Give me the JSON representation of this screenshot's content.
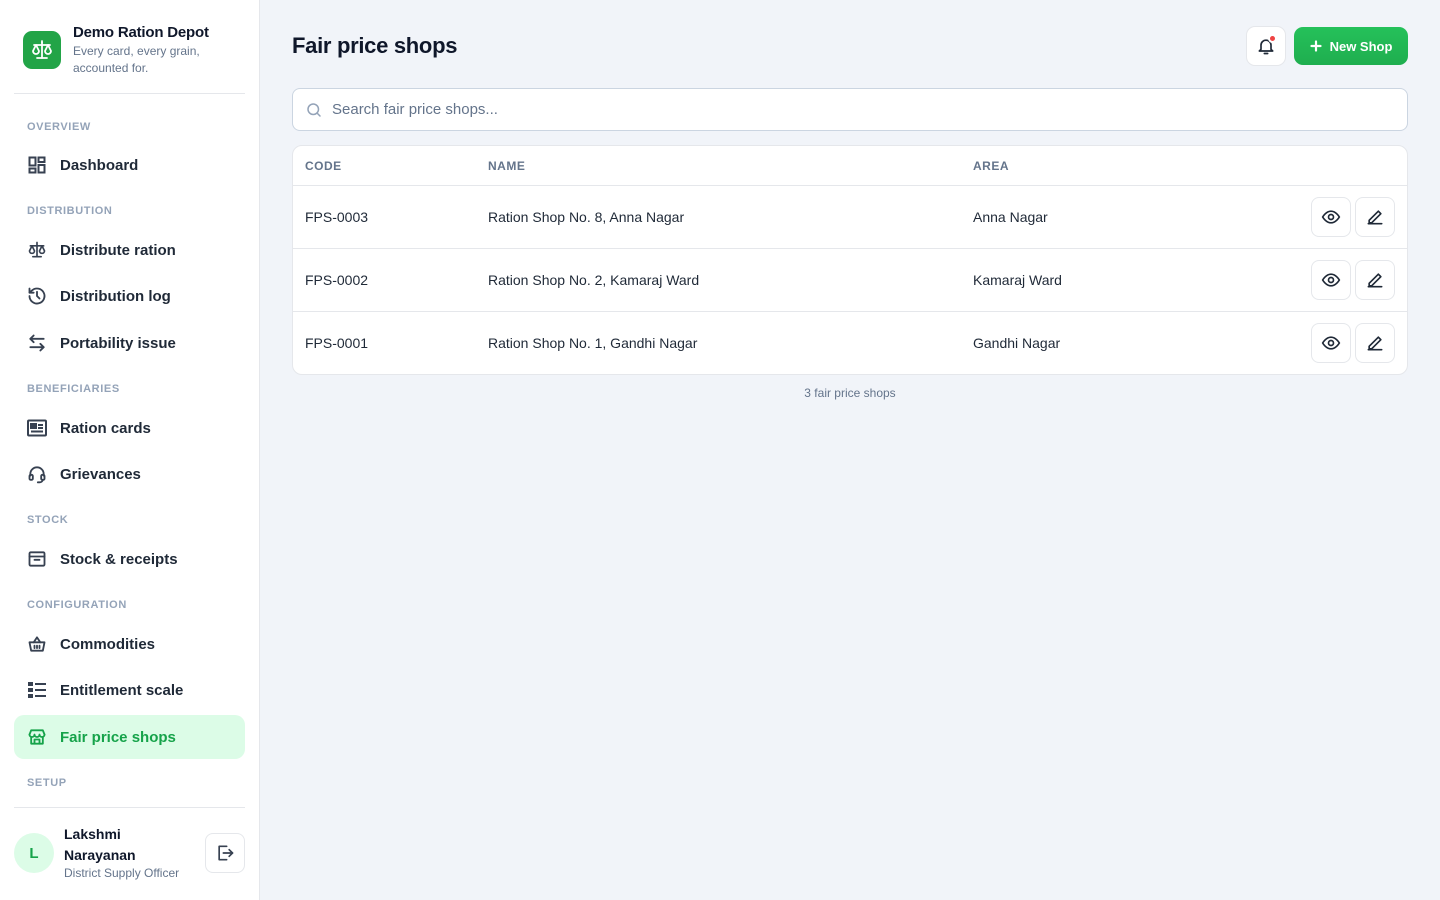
{
  "brand": {
    "name": "Demo Ration Depot",
    "tagline": "Every card, every grain, accounted for."
  },
  "sidebar": {
    "sections": [
      {
        "label": "OVERVIEW"
      },
      {
        "label": "DISTRIBUTION"
      },
      {
        "label": "BENEFICIARIES"
      },
      {
        "label": "STOCK"
      },
      {
        "label": "CONFIGURATION"
      },
      {
        "label": "SETUP"
      }
    ],
    "items": [
      {
        "label": "Dashboard",
        "icon": "dashboard-icon"
      },
      {
        "label": "Distribute ration",
        "icon": "scale-icon"
      },
      {
        "label": "Distribution log",
        "icon": "history-icon"
      },
      {
        "label": "Portability issue",
        "icon": "swap-arrows-icon"
      },
      {
        "label": "Ration cards",
        "icon": "id-card-icon"
      },
      {
        "label": "Grievances",
        "icon": "headset-icon"
      },
      {
        "label": "Stock & receipts",
        "icon": "archive-box-icon"
      },
      {
        "label": "Commodities",
        "icon": "basket-icon"
      },
      {
        "label": "Entitlement scale",
        "icon": "list-grid-icon"
      },
      {
        "label": "Fair price shops",
        "icon": "store-icon",
        "active": true
      }
    ]
  },
  "user": {
    "initial": "L",
    "name": "Lakshmi Narayanan",
    "role": "District Supply Officer"
  },
  "header": {
    "title": "Fair price shops",
    "new_button": "New Shop"
  },
  "search": {
    "placeholder": "Search fair price shops...",
    "value": ""
  },
  "table": {
    "columns": [
      "CODE",
      "NAME",
      "AREA"
    ],
    "rows": [
      {
        "code": "FPS-0003",
        "name": "Ration Shop No. 8, Anna Nagar",
        "area": "Anna Nagar"
      },
      {
        "code": "FPS-0002",
        "name": "Ration Shop No. 2, Kamaraj Ward",
        "area": "Kamaraj Ward"
      },
      {
        "code": "FPS-0001",
        "name": "Ration Shop No. 1, Gandhi Nagar",
        "area": "Gandhi Nagar"
      }
    ]
  },
  "footer": {
    "count": "3 fair price shops"
  },
  "colors": {
    "accent": "#22c55e",
    "active_bg": "#dcfce7",
    "active_text": "#16a34a",
    "notification": "#ef4444"
  }
}
